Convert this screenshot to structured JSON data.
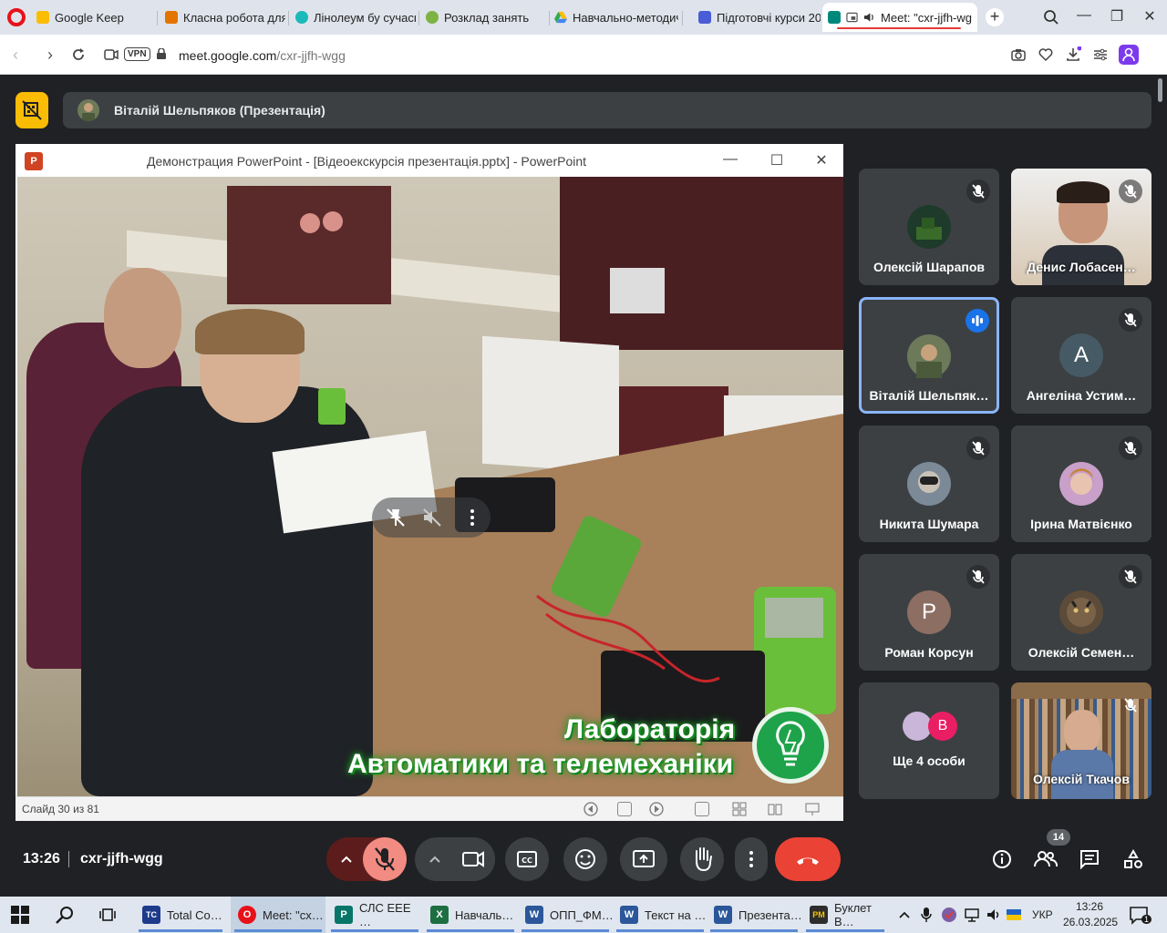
{
  "browser": {
    "tabs": [
      {
        "label": "Google Keep",
        "color": "#fbbc04"
      },
      {
        "label": "Класна робота для к",
        "color": "#e37400"
      },
      {
        "label": "Лінолеум бу сучасн",
        "color": "#1bb9b9"
      },
      {
        "label": "Розклад занять",
        "color": "#7cb342"
      },
      {
        "label": "Навчально-методич",
        "color": "#1a73e8"
      },
      {
        "label": "Підготовчі курси 20",
        "color": "#4a5cd6"
      },
      {
        "label": "Meet: \"cxr-jjfh-wg",
        "color": "#00897b"
      }
    ],
    "new_tab_label": "+",
    "url_host": "meet.google.com",
    "url_path": "/cxr-jjfh-wgg",
    "vpn_label": "VPN"
  },
  "meet": {
    "presenter_label": "Віталій Шельпяков (Презентація)",
    "time": "13:26",
    "meeting_code": "cxr-jjfh-wgg",
    "people_count": "14",
    "participants": [
      {
        "name": "Олексій Шарапов",
        "kind": "photo",
        "color": "#3a6b2a"
      },
      {
        "name": "Денис Лобасен…",
        "kind": "video",
        "color": "#d9c7b2"
      },
      {
        "name": "Віталій Шельпяк…",
        "kind": "photo",
        "color": "#6d7a5a",
        "speaking": true
      },
      {
        "name": "Ангеліна Устим…",
        "kind": "letter",
        "letter": "А",
        "color": "#455a64"
      },
      {
        "name": "Никита Шумара",
        "kind": "photo",
        "color": "#7b8a96"
      },
      {
        "name": "Ірина Матвієнко",
        "kind": "photo",
        "color": "#c9a0c9"
      },
      {
        "name": "Роман Корсун",
        "kind": "letter",
        "letter": "Р",
        "color": "#8d6e63"
      },
      {
        "name": "Олексій Семен…",
        "kind": "photo",
        "color": "#5d4b3a"
      },
      {
        "name": "Ще 4 особи",
        "kind": "group",
        "letter": "В",
        "color": "#e91e63"
      },
      {
        "name": "Олексій Ткачов",
        "kind": "video",
        "color": "#8a6b4a"
      }
    ]
  },
  "ppt": {
    "logo": "P",
    "window_title": "Демонстрация PowerPoint - [Відеоекскурсія презентація.pptx] - PowerPoint",
    "slide_counter": "Слайд 30 из 81",
    "slide_caption_line1": "Лабораторія",
    "slide_caption_line2": "Автоматики та телемеханіки"
  },
  "taskbar": {
    "items": [
      {
        "label": "Total Co…",
        "icon": "TC",
        "color": "#1e3a8a"
      },
      {
        "label": "Meet: \"cx…",
        "icon": "O",
        "color": "#e8111a",
        "active": true
      },
      {
        "label": "СЛС ЕЕЕ …",
        "icon": "P",
        "color": "#077568"
      },
      {
        "label": "Навчаль…",
        "icon": "X",
        "color": "#1d6f42"
      },
      {
        "label": "ОПП_ФМ…",
        "icon": "W",
        "color": "#2b579a"
      },
      {
        "label": "Текст на …",
        "icon": "W",
        "color": "#2b579a"
      },
      {
        "label": "Презента…",
        "icon": "W",
        "color": "#2b579a"
      },
      {
        "label": "Буклет В…",
        "icon": "PM",
        "color": "#2d2d2d"
      }
    ],
    "language": "УКР",
    "clock_time": "13:26",
    "clock_date": "26.03.2025",
    "notification_count": "1"
  }
}
